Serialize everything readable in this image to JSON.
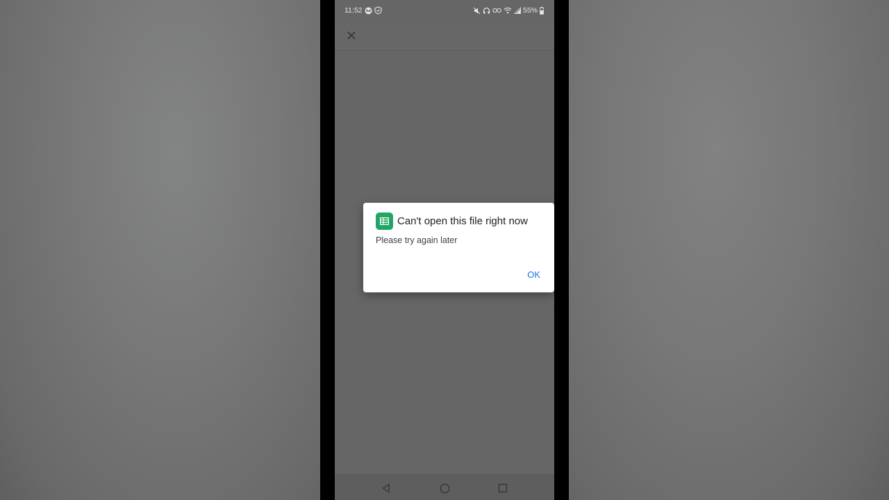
{
  "status_bar": {
    "time": "11:52",
    "battery_percent": "55%"
  },
  "app_bar": {
    "close_icon": "close-icon"
  },
  "dialog": {
    "app_icon": "google-sheets-icon",
    "title": "Can't open this file right now",
    "message": "Please try again later",
    "ok_label": "OK",
    "accent_color": "#1a73e8",
    "icon_color": "#23a566"
  },
  "nav_bar": {
    "back_icon": "back-triangle-icon",
    "home_icon": "home-circle-icon",
    "recents_icon": "recents-square-icon"
  }
}
